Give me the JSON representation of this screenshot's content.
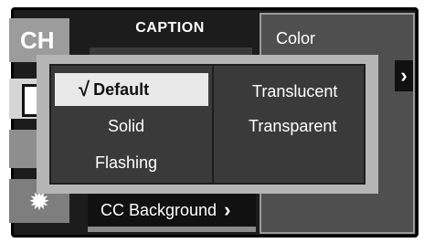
{
  "caption": {
    "title": "CAPTION"
  },
  "sidebar": {
    "ch_label": "CH"
  },
  "color_panel": {
    "label": "Color",
    "chevron": "›"
  },
  "popup": {
    "left_options": [
      {
        "label": "Default",
        "selected": true,
        "check": "√"
      },
      {
        "label": "Solid"
      },
      {
        "label": "Flashing"
      }
    ],
    "right_options": [
      {
        "label": "Translucent"
      },
      {
        "label": "Transparent"
      }
    ]
  },
  "menu": {
    "cc_background": "CC Background",
    "chevron": "›"
  },
  "colors": {
    "frame": "#1c1c1c",
    "popup_border": "#b5b5b5",
    "popup_bg": "#3a3a3a",
    "selected_bg": "#e9e9e9"
  }
}
